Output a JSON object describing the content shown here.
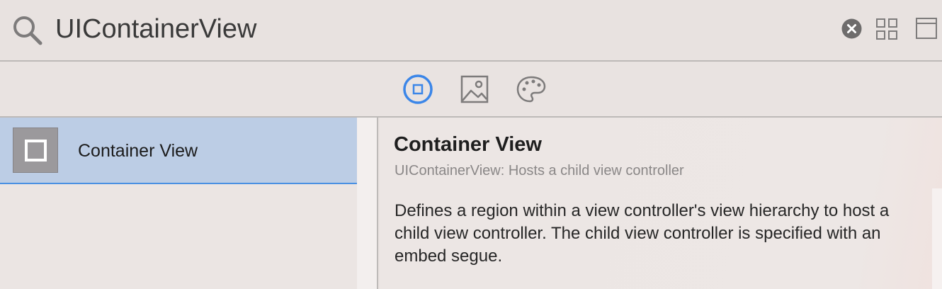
{
  "search": {
    "value": "UIContainerView",
    "icon": "search-icon"
  },
  "toolbar": {
    "clear_icon": "clear-icon",
    "grid_icon": "grid-view-icon",
    "panel_icon": "panel-icon"
  },
  "tabs": [
    {
      "icon": "objects-icon",
      "selected": true
    },
    {
      "icon": "media-icon",
      "selected": false
    },
    {
      "icon": "colors-icon",
      "selected": false
    }
  ],
  "library": {
    "items": [
      {
        "label": "Container View",
        "icon": "container-view-icon",
        "selected": true
      }
    ]
  },
  "detail": {
    "title": "Container View",
    "subtitle": "UIContainerView: Hosts a child view controller",
    "description": "Defines a region within a view controller's view hierarchy to host a child view controller. The child view controller is specified with an embed segue."
  },
  "colors": {
    "accent": "#3b86e8",
    "selection": "#bccde5",
    "selection_border": "#4a90e2",
    "background": "#e8e2e0"
  }
}
